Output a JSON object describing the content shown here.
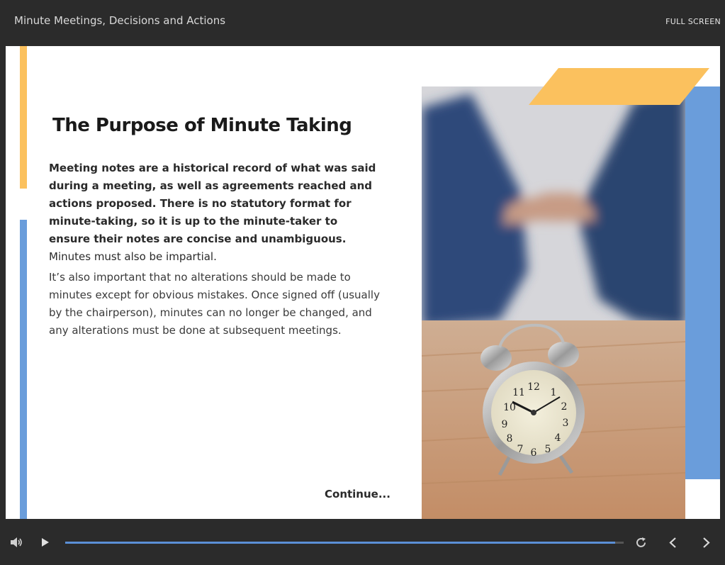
{
  "header": {
    "course_title": "Minute Meetings, Decisions and Actions",
    "fullscreen_label": "FULL SCREEN"
  },
  "slide": {
    "title": "The Purpose of Minute Taking",
    "para1_bold": "Meeting notes are a historical record of what was said during a meeting, as well as agreements reached and actions proposed. There is no statutory format for minute-taking, so it is up to the minute-taker to ensure their notes are concise and unambiguous.",
    "para1_normal": " Minutes must also be impartial.",
    "para2": "It’s also important that no alterations should be made to minutes except for obvious mistakes. Once signed off (usually by the chairperson), minutes can no longer be changed, and any alterations must be done at subsequent meetings.",
    "continue_label": "Continue...",
    "image_icon": "alarm-clock-handshake-photo"
  },
  "controls": {
    "progress_fraction": 0.985,
    "icons": [
      "volume-icon",
      "play-icon",
      "replay-icon",
      "previous-icon",
      "next-icon"
    ]
  },
  "colors": {
    "background": "#2b2b2b",
    "accent_yellow": "#fbc15e",
    "accent_blue": "#6a9ddb",
    "progress": "#5b8fd6"
  }
}
